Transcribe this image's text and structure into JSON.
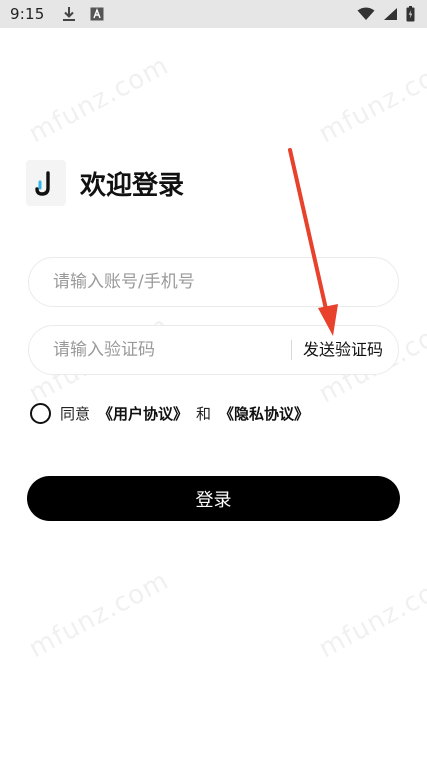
{
  "status_bar": {
    "time": "9:15",
    "left_icons": [
      "download-icon",
      "font-a-icon"
    ],
    "right_icons": [
      "wifi-icon",
      "signal-icon",
      "battery-charging-icon"
    ]
  },
  "watermark_text": "mfunz.com",
  "header": {
    "logo_letter": "J",
    "title": "欢迎登录"
  },
  "account_input": {
    "placeholder": "请输入账号/手机号",
    "value": ""
  },
  "code_input": {
    "placeholder": "请输入验证码",
    "value": "",
    "send_code_label": "发送验证码"
  },
  "agreement": {
    "checked": false,
    "prefix": "同意",
    "user_agreement": "《用户协议》",
    "and": "和",
    "privacy_policy": "《隐私协议》"
  },
  "login_button_label": "登录",
  "colors": {
    "primary": "#000000",
    "status_bar": "#e6e6e6",
    "annotation_arrow": "#e8412c",
    "logo_accent": "#2fb6e8"
  }
}
